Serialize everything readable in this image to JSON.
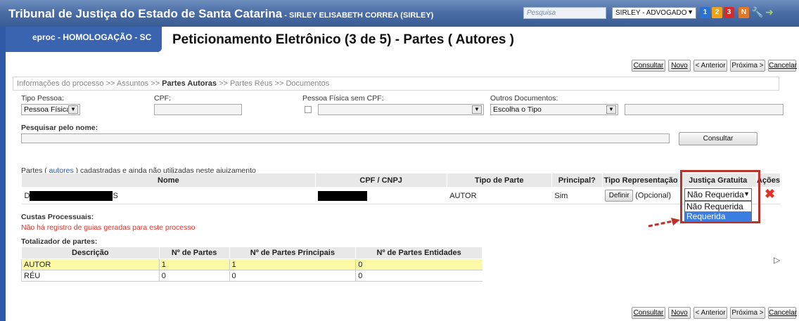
{
  "header": {
    "title": "Tribunal de Justiça do Estado de Santa Catarina",
    "subtitle": " - SIRLEY ELISABETH CORREA (SIRLEY)",
    "search_placeholder": "Pesquisa",
    "user_profile": "SIRLEY - ADVOGADO",
    "numbered_badges": [
      "1",
      "2",
      "3"
    ],
    "badge_colors": [
      "#2a73d6",
      "#f0a21c",
      "#d62b2b"
    ],
    "n_badge": "N"
  },
  "env_label": "eproc - HOMOLOGAÇÃO - SC",
  "page_title": "Peticionamento Eletrônico (3 de 5) - Partes ( Autores )",
  "toolbar": {
    "consultar": "Consultar",
    "novo": "Novo",
    "anterior": "< Anterior",
    "proxima": "Próxima >",
    "cancelar": "Cancelar"
  },
  "breadcrumb": {
    "step1": "Informações do processo",
    "step2": "Assuntos",
    "step3": "Partes Autoras",
    "step4": "Partes Réus",
    "step5": "Documentos",
    "sep": ">>"
  },
  "form": {
    "tipo_pessoa_label": "Tipo Pessoa:",
    "tipo_pessoa_value": "Pessoa Física",
    "cpf_label": "CPF:",
    "sem_cpf_label": "Pessoa Física sem CPF:",
    "outros_docs_label": "Outros Documentos:",
    "outros_docs_value": "Escolha o Tipo",
    "pesquisar_nome_label": "Pesquisar pelo nome:",
    "consultar_button": "Consultar"
  },
  "parties": {
    "section_prefix": "Partes (",
    "section_link": " autores ",
    "section_suffix": ") cadastradas e ainda não utilizadas neste ajuizamento",
    "columns": [
      "Nome",
      "CPF / CNPJ",
      "Tipo de Parte",
      "Principal?",
      "Tipo Representação",
      "Justiça Gratuita",
      "Ações"
    ],
    "row": {
      "name_start": "D",
      "name_end": "S",
      "tipo": "AUTOR",
      "principal": "Sim",
      "definir": "Definir",
      "opcional": "(Opcional)",
      "justica_value": "Não Requerida"
    },
    "justica_options": [
      "Não Requerida",
      "Requerida"
    ]
  },
  "custas": {
    "title": "Custas Processuais:",
    "message": "Não há registro de guias geradas para este processo"
  },
  "totalizador": {
    "title": "Totalizador de partes:",
    "columns": [
      "Descrição",
      "Nº de Partes",
      "Nº de Partes Principais",
      "Nº de Partes Entidades"
    ],
    "rows": [
      [
        "AUTOR",
        "1",
        "1",
        "0"
      ],
      [
        "RÉU",
        "0",
        "0",
        "0"
      ]
    ]
  }
}
